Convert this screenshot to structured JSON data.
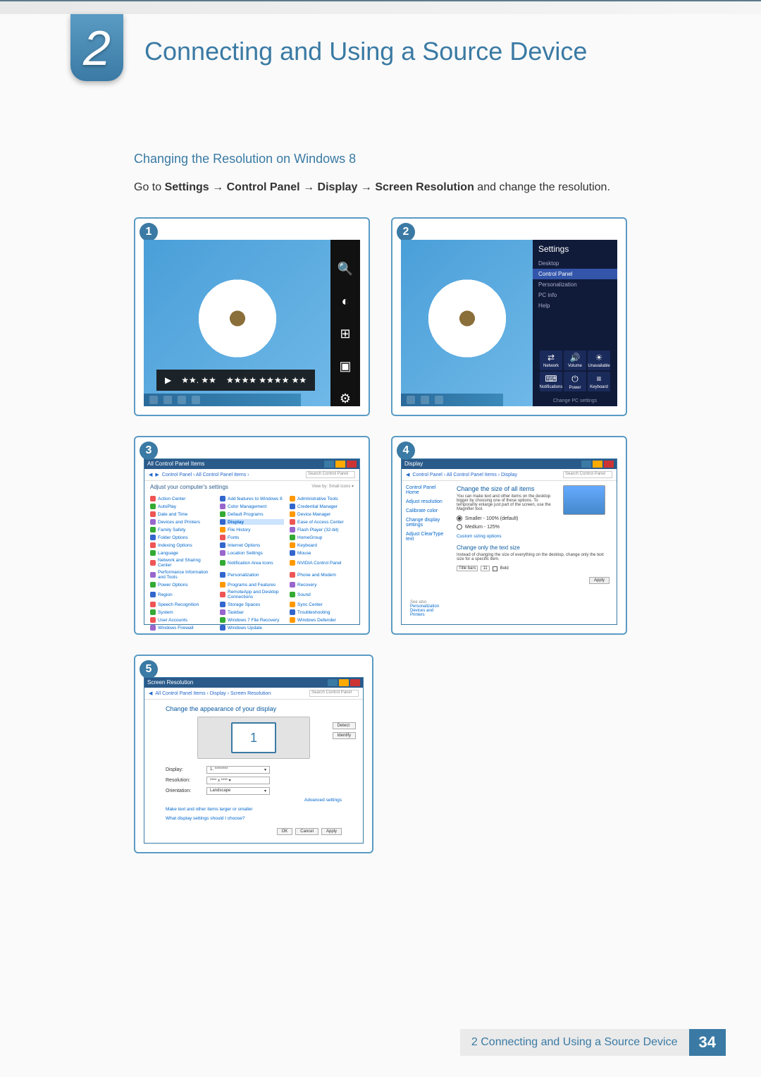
{
  "chapter": {
    "number": "2",
    "title": "Connecting and Using a Source Device"
  },
  "section": {
    "subtitle": "Changing the Resolution on Windows 8"
  },
  "instruction": {
    "pre": "Go to ",
    "p1": "Settings",
    "p2": "Control Panel",
    "p3": "Display",
    "p4": "Screen Resolution",
    "post": " and change the resolution.",
    "arrow": "→"
  },
  "badges": {
    "s1": "1",
    "s2": "2",
    "s3": "3",
    "s4": "4",
    "s5": "5"
  },
  "shot1": {
    "media_stars": "★★. ★★",
    "media_dots": "★★★★\n★★★★ ★★"
  },
  "shot2": {
    "title": "Settings",
    "items": [
      "Desktop",
      "Control Panel",
      "Personalization",
      "PC info",
      "Help"
    ],
    "tiles": [
      {
        "glyph": "⇄",
        "label": "Network"
      },
      {
        "glyph": "🔊",
        "label": "Volume"
      },
      {
        "glyph": "☀",
        "label": "Unavailable"
      },
      {
        "glyph": "⌨",
        "label": "Notifications"
      },
      {
        "glyph": "⏻",
        "label": "Power"
      },
      {
        "glyph": "≡",
        "label": "Keyboard"
      }
    ],
    "footer": "Change PC settings"
  },
  "shot3": {
    "title": "All Control Panel Items",
    "breadcrumb": "Control Panel › All Control Panel Items ›",
    "search_ph": "Search Control Panel",
    "adjust": "Adjust your computer's settings",
    "viewby": "View by: Small icons ▾",
    "items": [
      "Action Center",
      "Add features to Windows 8",
      "Administrative Tools",
      "AutoPlay",
      "Color Management",
      "Credential Manager",
      "Date and Time",
      "Default Programs",
      "Device Manager",
      "Devices and Printers",
      "Display",
      "Ease of Access Center",
      "Family Safety",
      "File History",
      "Flash Player (32-bit)",
      "Folder Options",
      "Fonts",
      "HomeGroup",
      "Indexing Options",
      "Internet Options",
      "Keyboard",
      "Language",
      "Location Settings",
      "Mouse",
      "Network and Sharing Center",
      "Notification Area Icons",
      "NVIDIA Control Panel",
      "Performance Information and Tools",
      "Personalization",
      "Phone and Modem",
      "Power Options",
      "Programs and Features",
      "Recovery",
      "Region",
      "RemoteApp and Desktop Connections",
      "Sound",
      "Speech Recognition",
      "Storage Spaces",
      "Sync Center",
      "System",
      "Taskbar",
      "Troubleshooting",
      "User Accounts",
      "Windows 7 File Recovery",
      "Windows Defender",
      "Windows Firewall",
      "Windows Update"
    ],
    "highlight": "Display"
  },
  "shot4": {
    "title": "Display",
    "breadcrumb": "Control Panel › All Control Panel Items › Display",
    "search_ph": "Search Control Panel",
    "side": [
      "Control Panel Home",
      "Adjust resolution",
      "Calibrate color",
      "Change display settings",
      "Adjust ClearType text"
    ],
    "h1": "Change the size of all items",
    "desc": "You can make text and other items on the desktop bigger by choosing one of these options. To temporarily enlarge just part of the screen, use the Magnifier tool.",
    "opt1": "Smaller - 100% (default)",
    "opt2": "Medium - 125%",
    "link1": "Custom sizing options",
    "h2": "Change only the text size",
    "desc2": "Instead of changing the size of everything on the desktop, change only the text size for a specific item.",
    "sel1": "Title bars",
    "sel2": "11",
    "bold": "Bold",
    "apply": "Apply",
    "seealso": "See also",
    "sa1": "Personalization",
    "sa2": "Devices and Printers"
  },
  "shot5": {
    "title": "Screen Resolution",
    "breadcrumb": "All Control Panel Items › Display › Screen Resolution",
    "search_ph": "Search Control Panel",
    "h1": "Change the appearance of your display",
    "detect": "Detect",
    "identify": "Identify",
    "mon": "1",
    "lbl_display": "Display:",
    "lbl_res": "Resolution:",
    "lbl_orient": "Orientation:",
    "val_display": "1. ********",
    "val_res": "**** x **** ▾",
    "val_orient": "Landscape",
    "adv": "Advanced settings",
    "link1": "Make text and other items larger or smaller",
    "link2": "What display settings should I choose?",
    "ok": "OK",
    "cancel": "Cancel",
    "apply": "Apply"
  },
  "footer": {
    "chapter_num": "2",
    "title": "Connecting and Using a Source Device",
    "page": "34"
  }
}
